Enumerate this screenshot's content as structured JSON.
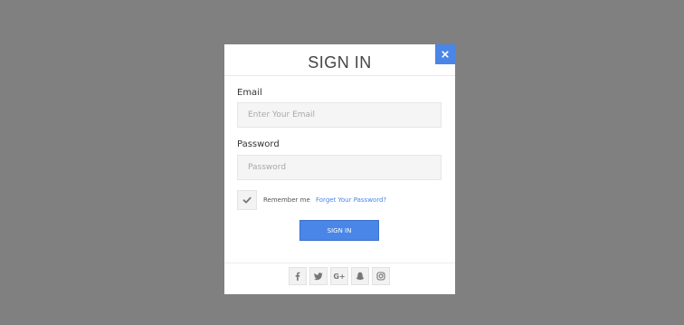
{
  "modal": {
    "title": "SIGN IN",
    "close_icon": "close-icon"
  },
  "form": {
    "email_label": "Email",
    "email_placeholder": "Enter Your Email",
    "email_value": "",
    "password_label": "Password",
    "password_placeholder": "Password",
    "password_value": "",
    "remember_checked": true,
    "remember_label": "Remember me",
    "forgot_link": "Forget Your Password?",
    "submit_label": "SIGN IN"
  },
  "social": [
    {
      "icon": "facebook-icon"
    },
    {
      "icon": "twitter-icon"
    },
    {
      "icon": "google-plus-icon",
      "glyph": "G+"
    },
    {
      "icon": "snapchat-icon"
    },
    {
      "icon": "instagram-icon"
    }
  ],
  "colors": {
    "backdrop": "#808080",
    "accent": "#4a86e8",
    "field_bg": "#f5f5f5"
  }
}
